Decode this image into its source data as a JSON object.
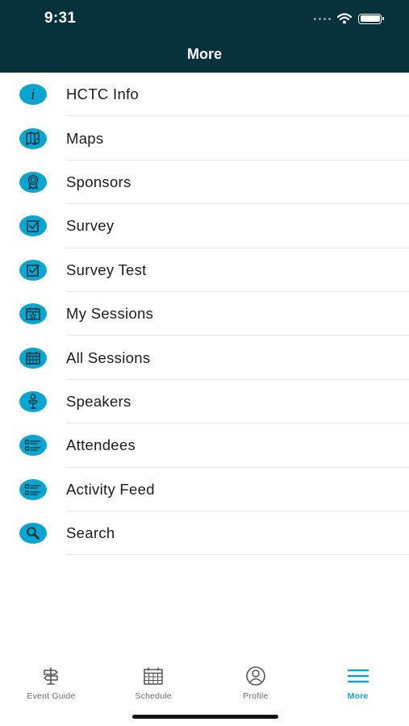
{
  "status_bar": {
    "time": "9:31"
  },
  "header": {
    "title": "More"
  },
  "menu": {
    "items": [
      {
        "label": "HCTC Info",
        "icon": "info-icon"
      },
      {
        "label": "Maps",
        "icon": "map-icon"
      },
      {
        "label": "Sponsors",
        "icon": "ribbon-award-icon"
      },
      {
        "label": "Survey",
        "icon": "checkbox-icon"
      },
      {
        "label": "Survey Test",
        "icon": "checkbox-icon"
      },
      {
        "label": "My Sessions",
        "icon": "calendar-star-icon"
      },
      {
        "label": "All Sessions",
        "icon": "calendar-grid-icon"
      },
      {
        "label": "Speakers",
        "icon": "podium-speaker-icon"
      },
      {
        "label": "Attendees",
        "icon": "list-icon"
      },
      {
        "label": "Activity Feed",
        "icon": "list-icon"
      },
      {
        "label": "Search",
        "icon": "search-icon"
      }
    ]
  },
  "tab_bar": {
    "tabs": [
      {
        "label": "Event Guide",
        "icon": "signpost-icon",
        "active": false
      },
      {
        "label": "Schedule",
        "icon": "calendar-icon",
        "active": false
      },
      {
        "label": "Profile",
        "icon": "profile-icon",
        "active": false
      },
      {
        "label": "More",
        "icon": "menu-icon",
        "active": true
      }
    ]
  },
  "colors": {
    "header_bg": "#07313b",
    "accent": "#0aa6d1",
    "divider": "#e6e6e6"
  }
}
